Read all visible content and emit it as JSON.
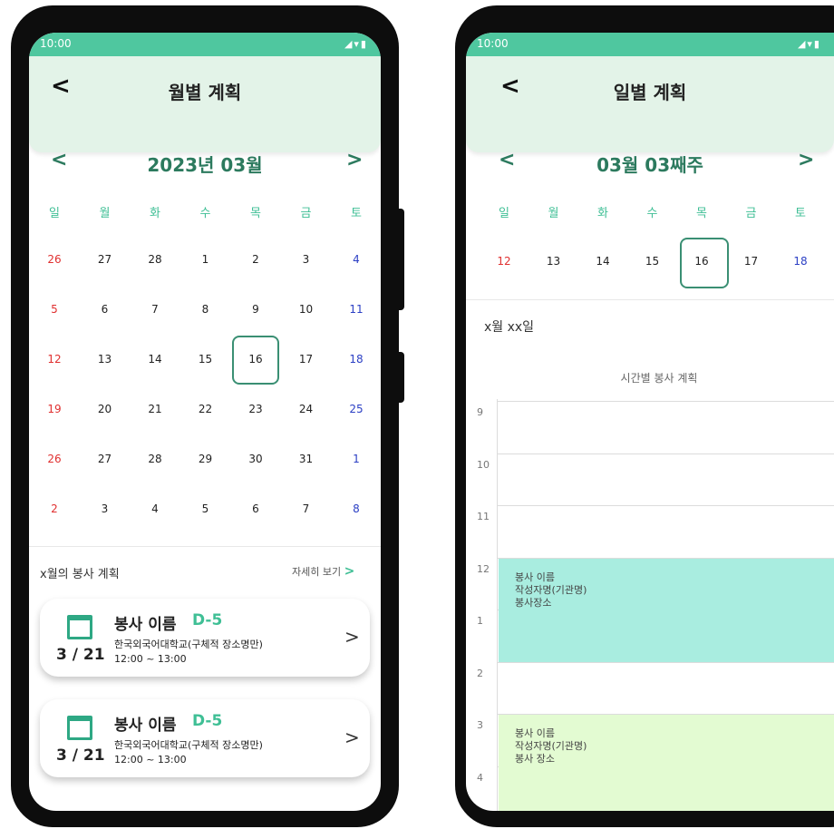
{
  "monthly": {
    "status": {
      "time": "10:00",
      "icons": "◢▾▮"
    },
    "appbar": {
      "back": "<",
      "title": "월별 계획"
    },
    "month_nav": {
      "prev": "<",
      "title": "2023년 03월",
      "next": ">"
    },
    "weekdays": [
      "일",
      "월",
      "화",
      "수",
      "목",
      "금",
      "토"
    ],
    "weeks": [
      [
        "26",
        "27",
        "28",
        "1",
        "2",
        "3",
        "4"
      ],
      [
        "5",
        "6",
        "7",
        "8",
        "9",
        "10",
        "11"
      ],
      [
        "12",
        "13",
        "14",
        "15",
        "16",
        "17",
        "18"
      ],
      [
        "19",
        "20",
        "21",
        "22",
        "23",
        "24",
        "25"
      ],
      [
        "26",
        "27",
        "28",
        "29",
        "30",
        "31",
        "1"
      ],
      [
        "2",
        "3",
        "4",
        "5",
        "6",
        "7",
        "8"
      ]
    ],
    "selected": "16",
    "section": {
      "title": "x월의 봉사 계획",
      "more": "자세히 보기",
      "more_arrow": ">"
    },
    "cards": [
      {
        "date": "3 / 21",
        "name": "봉사 이름",
        "dday": "D-5",
        "place": "한국외국어대학교(구체적 장소명만)",
        "time": "12:00 ~ 13:00",
        "arrow": ">"
      },
      {
        "date": "3 / 21",
        "name": "봉사 이름",
        "dday": "D-5",
        "place": "한국외국어대학교(구체적 장소명만)",
        "time": "12:00 ~ 13:00",
        "arrow": ">"
      }
    ],
    "colors": {
      "primary": "#4fc79f",
      "accent": "#2c7a5e",
      "appbar": "#e3f3e8",
      "sunday": "#e03030",
      "saturday": "#2b3fc4"
    }
  },
  "daily": {
    "status": {
      "time": "10:00",
      "icons": "◢▾▮"
    },
    "appbar": {
      "back": "<",
      "title": "일별 계획"
    },
    "week_nav": {
      "prev": "<",
      "title": "03월 03째주",
      "next": ">"
    },
    "weekdays": [
      "일",
      "월",
      "화",
      "수",
      "목",
      "금",
      "토"
    ],
    "days": [
      "12",
      "13",
      "14",
      "15",
      "16",
      "17",
      "18"
    ],
    "selected": "16",
    "date_label": "x월 xx일",
    "schedule_title": "시간별 봉사 계획",
    "hours": [
      "9",
      "10",
      "11",
      "12",
      "1",
      "2",
      "3",
      "4"
    ],
    "events": [
      {
        "lines": [
          "봉사 이름",
          "작성자명(기관명)",
          "봉사장소"
        ],
        "color": "#a9ede0"
      },
      {
        "lines": [
          "봉사 이름",
          "작성자명(기관명)",
          "봉사 장소"
        ],
        "color": "#e3fbd2"
      }
    ]
  }
}
